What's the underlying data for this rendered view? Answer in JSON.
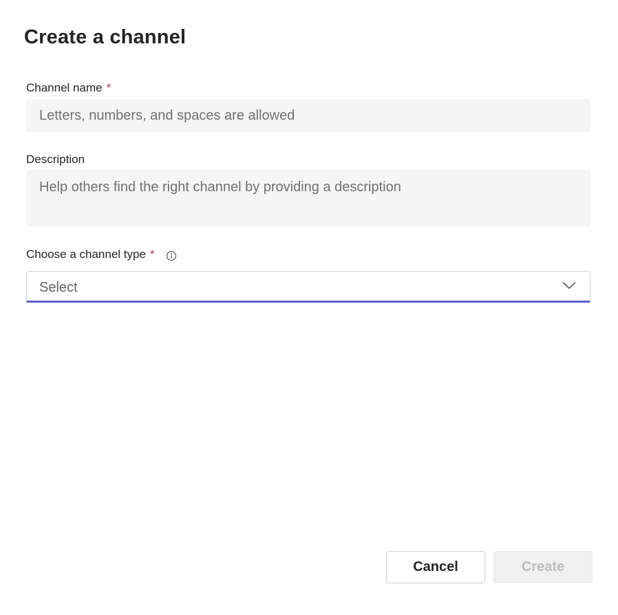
{
  "dialog": {
    "title": "Create a channel"
  },
  "channel_name": {
    "label": "Channel name",
    "required_mark": "*",
    "placeholder": "Letters, numbers, and spaces are allowed",
    "value": ""
  },
  "description": {
    "label": "Description",
    "placeholder": "Help others find the right channel by providing a description",
    "value": ""
  },
  "channel_type": {
    "label": "Choose a channel type",
    "required_mark": "*",
    "info_icon": "info-icon",
    "selected": "Select",
    "dropdown_icon": "chevron-down-icon"
  },
  "actions": {
    "cancel_label": "Cancel",
    "create_label": "Create",
    "create_enabled": false
  },
  "colors": {
    "accent": "#5b5fc7",
    "required": "#c4314b",
    "field_bg": "#f5f5f5"
  }
}
